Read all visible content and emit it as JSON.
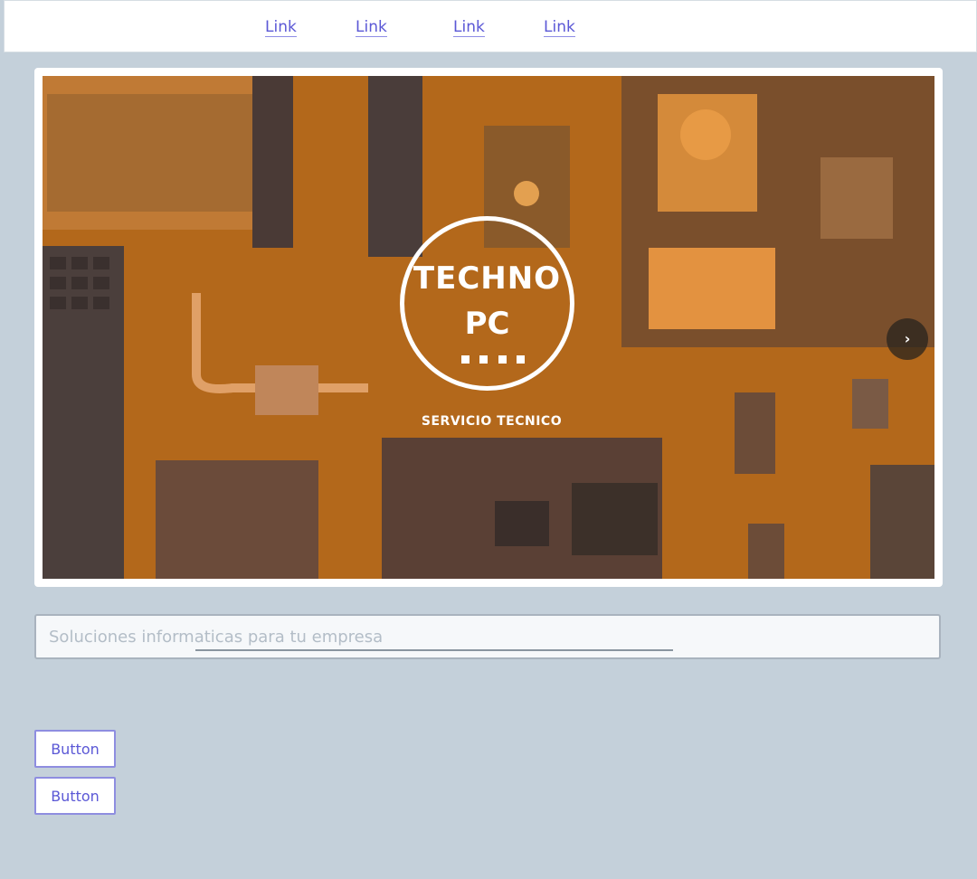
{
  "nav": {
    "links": [
      "Link",
      "Link",
      "Link",
      "Link"
    ]
  },
  "hero": {
    "logo_line1": "TECHNO",
    "logo_line2": "PC",
    "caption": "SERVICIO TECNICO",
    "next_icon": "chevron-right-icon",
    "next_glyph": "›"
  },
  "search": {
    "placeholder": "Soluciones informaticas para tu empresa"
  },
  "buttons": [
    "Button",
    "Button"
  ],
  "colors": {
    "background": "#c4d0da",
    "link": "#5b58d6",
    "hero_tint": "#b86c1e"
  }
}
